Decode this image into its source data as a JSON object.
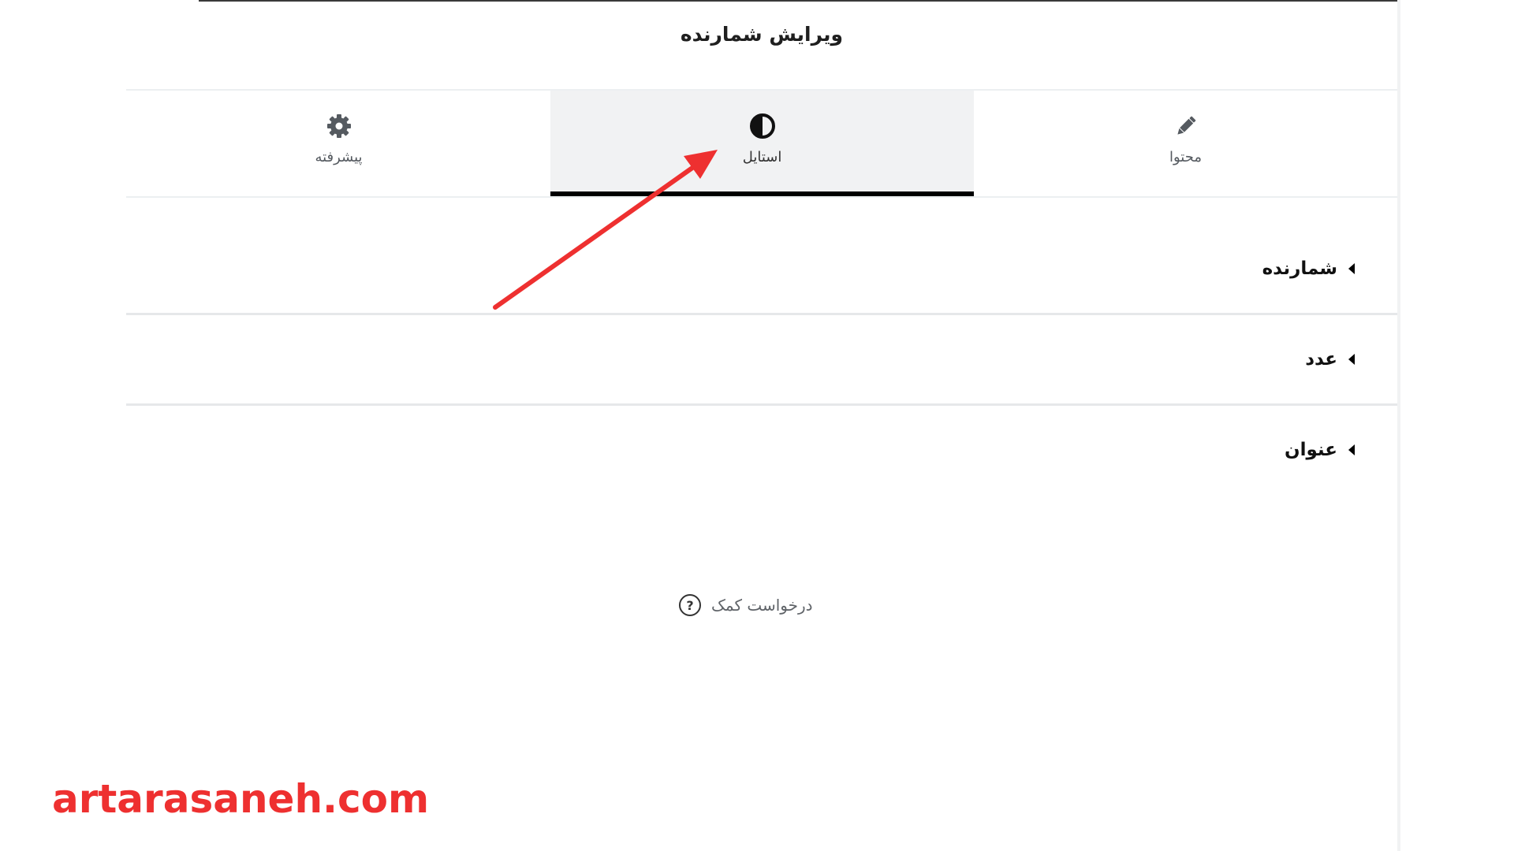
{
  "panel": {
    "title": "ویرایش شمارنده"
  },
  "tabs": [
    {
      "label": "محتوا",
      "icon": "pencil-icon",
      "active": false
    },
    {
      "label": "استایل",
      "icon": "half-circle-contrast-icon",
      "active": true
    },
    {
      "label": "پیشرفته",
      "icon": "gear-icon",
      "active": false
    }
  ],
  "sections": [
    {
      "label": "شمارنده",
      "expanded": false
    },
    {
      "label": "عدد",
      "expanded": false
    },
    {
      "label": "عنوان",
      "expanded": false
    }
  ],
  "help": {
    "label": "درخواست کمک",
    "icon": "question-circle-icon"
  },
  "annotation": {
    "arrow_color": "#ee3030",
    "watermark": "artarasaneh.com"
  },
  "colors": {
    "active_tab_bg": "#f1f2f3",
    "active_tab_indicator": "#000000",
    "accent_red": "#ee3030"
  }
}
